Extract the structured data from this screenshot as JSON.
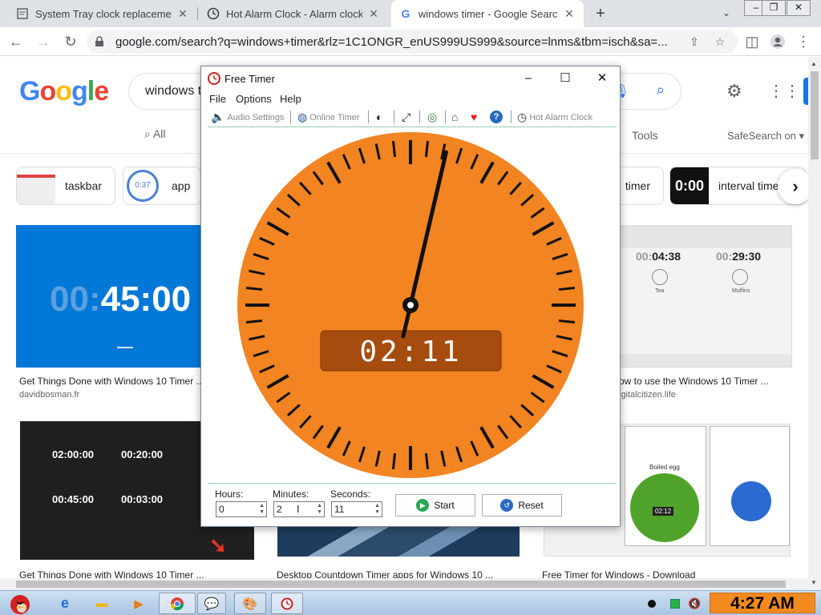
{
  "browser": {
    "tabs": [
      {
        "title": "System Tray clock replacement",
        "icon": "document-icon",
        "active": false
      },
      {
        "title": "Hot Alarm Clock - Alarm clock",
        "icon": "clock-icon",
        "active": false
      },
      {
        "title": "windows timer - Google Search",
        "icon": "google-g-icon",
        "active": true
      }
    ],
    "new_tab_label": "+",
    "url": "google.com/search?q=windows+timer&rlz=1C1ONGR_enUS999US999&source=lnms&tbm=isch&sa=..."
  },
  "google": {
    "logo_text": "Google",
    "search_query": "windows t",
    "nav_all": "All",
    "tools": "Tools",
    "safesearch": "SafeSearch on",
    "chips": [
      {
        "label": "taskbar"
      },
      {
        "label": "app",
        "badge": "0:37"
      },
      {
        "label": "timer"
      },
      {
        "label": "interval time",
        "badge": "0:00"
      }
    ],
    "results": [
      {
        "caption": "Get Things Done with Windows 10 Timer ...",
        "source": "davidbosman.fr",
        "display": "00:45:00",
        "display_dim": "00:",
        "display_main": "45:00"
      },
      {
        "caption": "ow to use the Windows 10 Timer ...",
        "source": "igitalcitizen.life",
        "timer_a": "04:38",
        "timer_b": "29:30",
        "label_a": "Tea",
        "label_b": "Muffins"
      },
      {
        "caption": "Get Things Done with Windows 10 Timer ...",
        "timers": [
          "02:00:00",
          "00:20:00",
          "00:45:00",
          "00:03:00"
        ]
      },
      {
        "caption": "Desktop Countdown Timer apps for Windows 10 ..."
      },
      {
        "caption": "Free Timer for Windows - Download",
        "boiled": "Boiled egg",
        "mini_time": "02:12"
      }
    ]
  },
  "free_timer": {
    "title": "Free Timer",
    "menu": [
      "File",
      "Options",
      "Help"
    ],
    "toolbar": {
      "audio_settings": "Audio Settings",
      "online_timer": "Online Timer",
      "hot_alarm_clock": "Hot Alarm Clock"
    },
    "clock": {
      "digital": "02:11",
      "minutes_remaining": 2,
      "seconds_remaining": 11,
      "face_color": "#f28422",
      "display_color": "#a64c0e"
    },
    "fields": {
      "hours_label": "Hours:",
      "hours_value": "0",
      "minutes_label": "Minutes:",
      "minutes_value": "2",
      "seconds_label": "Seconds:",
      "seconds_value": "11"
    },
    "start_label": "Start",
    "reset_label": "Reset"
  },
  "taskbar": {
    "time": "4:27 AM"
  }
}
